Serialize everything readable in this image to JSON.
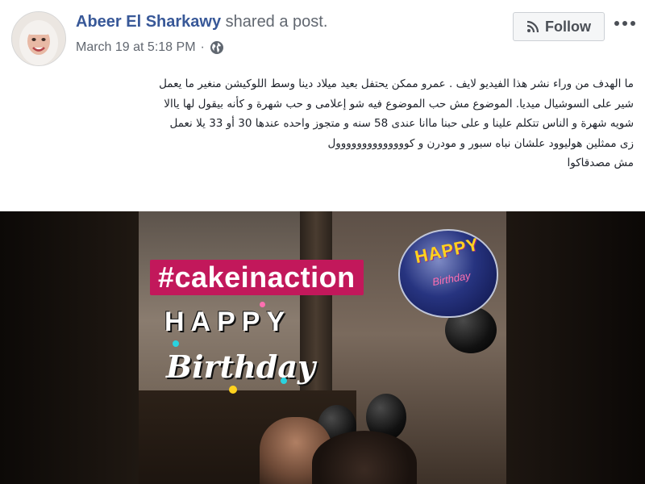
{
  "post": {
    "author": "Abeer El Sharkawy",
    "action": "shared a post.",
    "timestamp": "March 19 at 5:18 PM",
    "separator": "·",
    "privacy_icon": "globe-icon",
    "follow_label": "Follow",
    "follow_icon": "rss-icon",
    "more_icon": "more-options-icon"
  },
  "body": {
    "lines": [
      "ما الهدف من وراء نشر هذا الفيديو لايف . عمرو ممكن يحتفل بعيد ميلاد دينا وسط اللوكيشن منغير ما يعمل",
      "شير على السوشيال ميديا. الموضوع مش حب الموضوع فيه شو إعلامى و حب شهرة و كأنه بيقول لها ياالا",
      "شويه شهرة و الناس تتكلم علينا و على حبنا ماانا عندى 58 سنه و متجوز واحده عندها 30 أو 33 يلا نعمل",
      "زى ممثلين هوليوود علشان نباه سبور و مودرن و كوووووووووووووول",
      "مش مصدقاكوا"
    ]
  },
  "media": {
    "hashtag": "#cakeinaction",
    "happy": "HAPPY",
    "birthday": "Birthday",
    "balloon_text": "HAPPY",
    "balloon_sub": "Birthday"
  },
  "colors": {
    "author_link": "#385898",
    "meta_gray": "#616770",
    "hashtag_bg": "#c2185b",
    "balloon_text": "#ffd21e"
  }
}
